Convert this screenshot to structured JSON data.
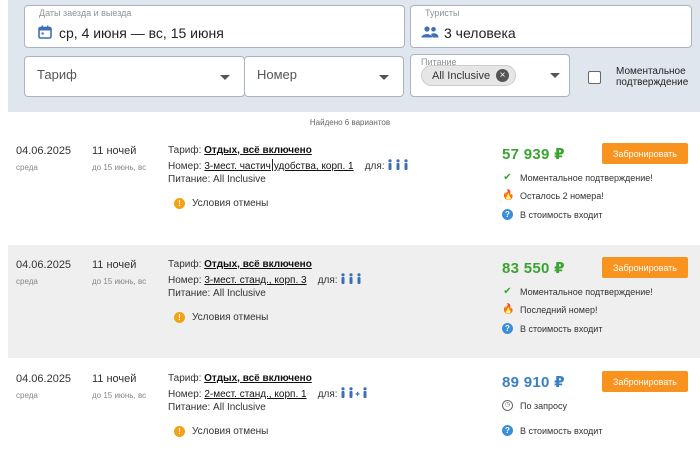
{
  "filters": {
    "dates": {
      "label": "Даты заезда и выезда",
      "value": "ср, 4 июня — вс, 15 июня"
    },
    "tourists": {
      "label": "Туристы",
      "value": "3 человека"
    },
    "tariff": {
      "placeholder": "Тариф"
    },
    "room": {
      "placeholder": "Номер"
    },
    "meal": {
      "label": "Питание",
      "chip": "All Inclusive"
    },
    "instant": {
      "label_line1": "Моментальное",
      "label_line2": "подтверждение"
    }
  },
  "found": "Найдено 6 вариантов",
  "results": [
    {
      "date": "04.06.2025",
      "dow": "среда",
      "nights": "11 ночей",
      "until": "до 15 июнь, вс",
      "tariff_label": "Тариф:",
      "tariff": "Отдых, всё включено",
      "room_label": "Номер:",
      "room": "3-мест. частич",
      "room_extra": "удобства, корп. 1",
      "for_label": "для:",
      "meal_label": "Питание:",
      "meal": "All Inclusive",
      "cancel": "Условия отмены",
      "price": "57 939 ₽",
      "price_color": "#3aa42f",
      "book": "Забронировать",
      "status1": "Моментальное подтверждение!",
      "status2": "Осталось 2 номера!",
      "status3": "В стоимость входит"
    },
    {
      "date": "04.06.2025",
      "dow": "среда",
      "nights": "11 ночей",
      "until": "до 15 июнь, вс",
      "tariff_label": "Тариф:",
      "tariff": "Отдых, всё включено",
      "room_label": "Номер:",
      "room": "3-мест. станд., корп. 3",
      "room_extra": "",
      "for_label": "для:",
      "meal_label": "Питание:",
      "meal": "All Inclusive",
      "cancel": "Условия отмены",
      "price": "83 550 ₽",
      "price_color": "#3aa42f",
      "book": "Забронировать",
      "status1": "Моментальное подтверждение!",
      "status2": "Последний номер!",
      "status3": "В стоимость входит"
    },
    {
      "date": "04.06.2025",
      "dow": "среда",
      "nights": "11 ночей",
      "until": "до 15 июнь, вс",
      "tariff_label": "Тариф:",
      "tariff": "Отдых, всё включено",
      "room_label": "Номер:",
      "room": "2-мест. станд., корп. 1",
      "room_extra": "",
      "for_label": "для:",
      "meal_label": "Питание:",
      "meal": "All Inclusive",
      "cancel": "Условия отмены",
      "price": "89 910 ₽",
      "price_color": "#3a7fc1",
      "book": "Забронировать",
      "status1": "По запросу",
      "status3": "В стоимость входит"
    }
  ],
  "icons": {
    "calendar": "calendar-icon",
    "tourists": "people-icon",
    "cancel": "info-icon",
    "instant": "check-icon",
    "rooms_left": "fire-icon",
    "on_request": "clock-icon",
    "included": "help-icon"
  }
}
